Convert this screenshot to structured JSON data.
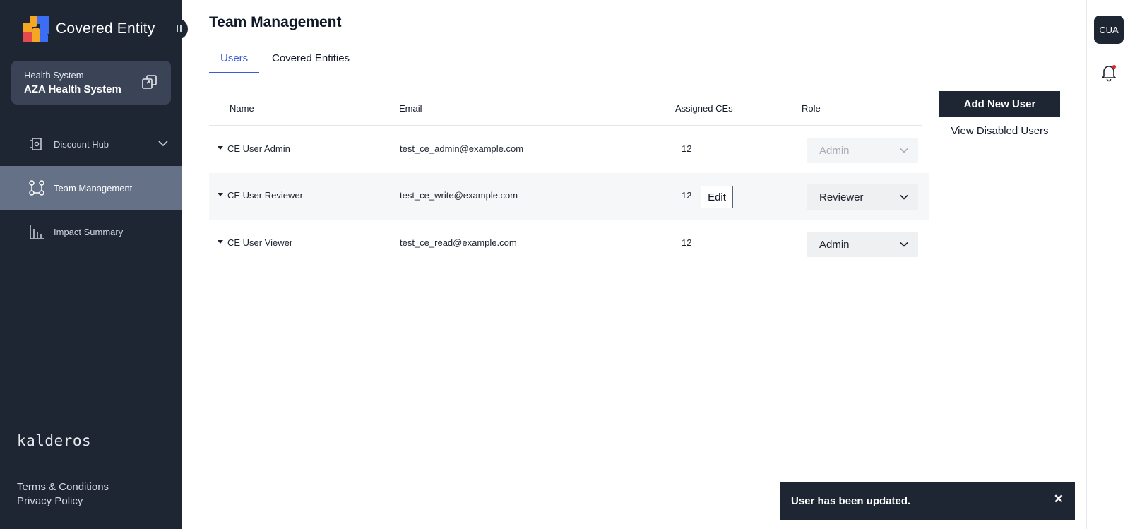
{
  "app": {
    "brand_name": "Covered Entity",
    "health_system_label": "Health System",
    "health_system_name": "AZA Health System",
    "company": "kalderos",
    "colors": {
      "sidebar": "#1f2633",
      "active_nav": "#647187",
      "accent": "#3b5bdb"
    }
  },
  "sidebar": {
    "items": [
      {
        "label": "Discount Hub",
        "icon": "document-icon"
      },
      {
        "label": "Team Management",
        "icon": "team-icon"
      },
      {
        "label": "Impact Summary",
        "icon": "bar-chart-icon"
      }
    ],
    "footer_links": [
      "Terms & Conditions",
      "Privacy Policy"
    ]
  },
  "main": {
    "title": "Team Management",
    "tabs": [
      {
        "label": "Users"
      },
      {
        "label": "Covered Entities"
      }
    ],
    "table": {
      "headers": {
        "name": "Name",
        "email": "Email",
        "assigned": "Assigned CEs",
        "role": "Role"
      },
      "rows": [
        {
          "name": "CE User Admin",
          "email": "test_ce_admin@example.com",
          "assigned": "12",
          "role": "Admin"
        },
        {
          "name": "CE User Reviewer",
          "email": "test_ce_write@example.com",
          "assigned": "12",
          "role": "Reviewer",
          "action": "Edit"
        },
        {
          "name": "CE User Viewer",
          "email": "test_ce_read@example.com",
          "assigned": "12",
          "role": "Admin"
        }
      ]
    },
    "add_user_label": "Add New User",
    "view_disabled_label": "View Disabled Users"
  },
  "rail": {
    "avatar_initials": "CUA"
  },
  "toast": {
    "message": "User has been updated.",
    "close": "✕"
  }
}
